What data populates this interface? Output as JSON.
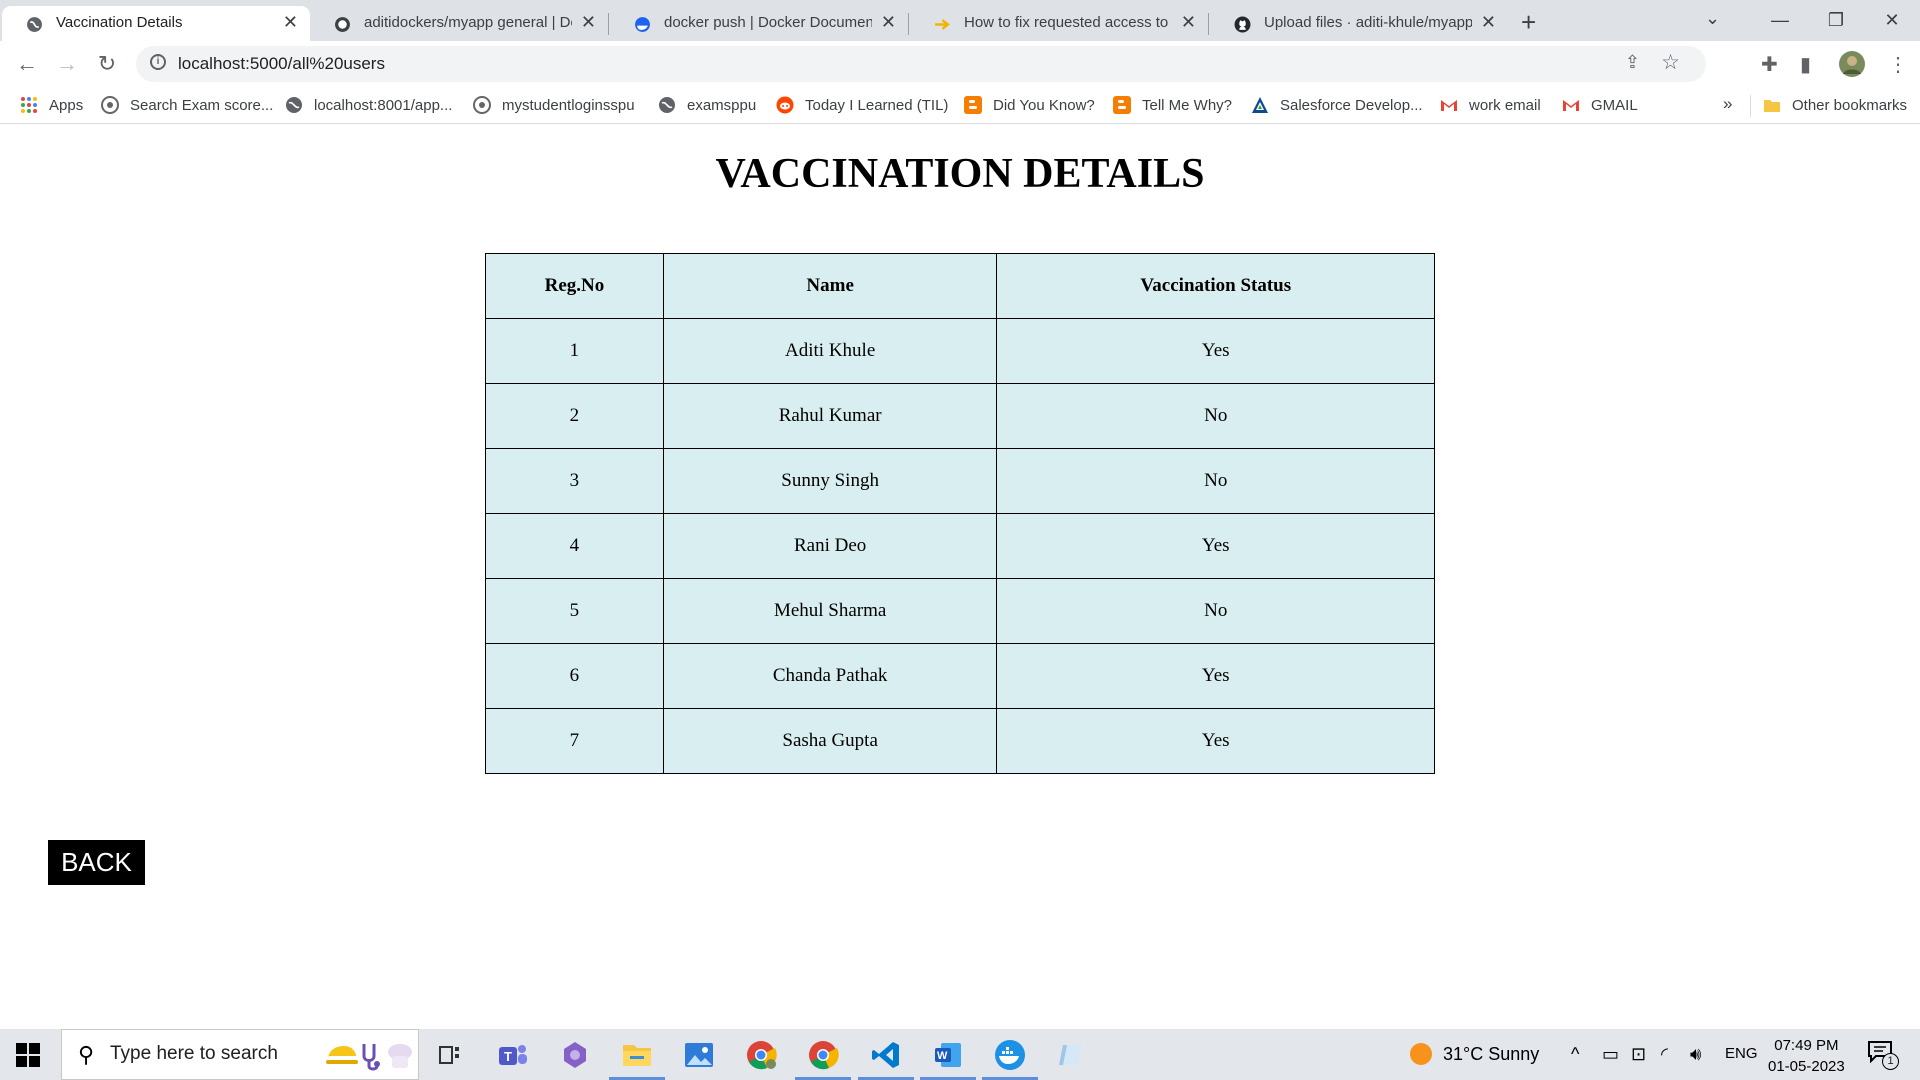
{
  "browser": {
    "tabs": [
      {
        "title": "Vaccination Details",
        "active": true
      },
      {
        "title": "aditidockers/myapp general | Do"
      },
      {
        "title": "docker push | Docker Documenta"
      },
      {
        "title": "How to fix requested access to th"
      },
      {
        "title": "Upload files · aditi-khule/myapp"
      }
    ],
    "url": "localhost:5000/all%20users",
    "bookmarks": [
      {
        "label": "Apps",
        "icon": "apps-grid-icon"
      },
      {
        "label": "Search Exam score...",
        "icon": "university-icon"
      },
      {
        "label": "localhost:8001/app...",
        "icon": "globe-icon"
      },
      {
        "label": "mystudentloginsspu",
        "icon": "university-icon"
      },
      {
        "label": "examsppu",
        "icon": "globe-icon"
      },
      {
        "label": "Today I Learned (TIL)",
        "icon": "reddit-icon"
      },
      {
        "label": "Did You Know?",
        "icon": "blogger-icon"
      },
      {
        "label": "Tell Me Why?",
        "icon": "blogger-icon"
      },
      {
        "label": "Salesforce Develop...",
        "icon": "salesforce-icon"
      },
      {
        "label": "work email",
        "icon": "gmail-icon"
      },
      {
        "label": "GMAIL",
        "icon": "gmail-icon"
      }
    ],
    "overflow_label": "»",
    "other_bookmarks": "Other bookmarks"
  },
  "page": {
    "title": "VACCINATION DETAILS",
    "table": {
      "headers": [
        "Reg.No",
        "Name",
        "Vaccination Status"
      ],
      "rows": [
        [
          "1",
          "Aditi Khule",
          "Yes"
        ],
        [
          "2",
          "Rahul Kumar",
          "No"
        ],
        [
          "3",
          "Sunny Singh",
          "No"
        ],
        [
          "4",
          "Rani Deo",
          "Yes"
        ],
        [
          "5",
          "Mehul Sharma",
          "No"
        ],
        [
          "6",
          "Chanda Pathak",
          "Yes"
        ],
        [
          "7",
          "Sasha Gupta",
          "Yes"
        ]
      ]
    },
    "back_label": "BACK"
  },
  "taskbar": {
    "search_placeholder": "Type here to search",
    "weather": "31°C  Sunny",
    "language": "ENG",
    "time": "07:49 PM",
    "date": "01-05-2023",
    "notification_count": "1"
  }
}
